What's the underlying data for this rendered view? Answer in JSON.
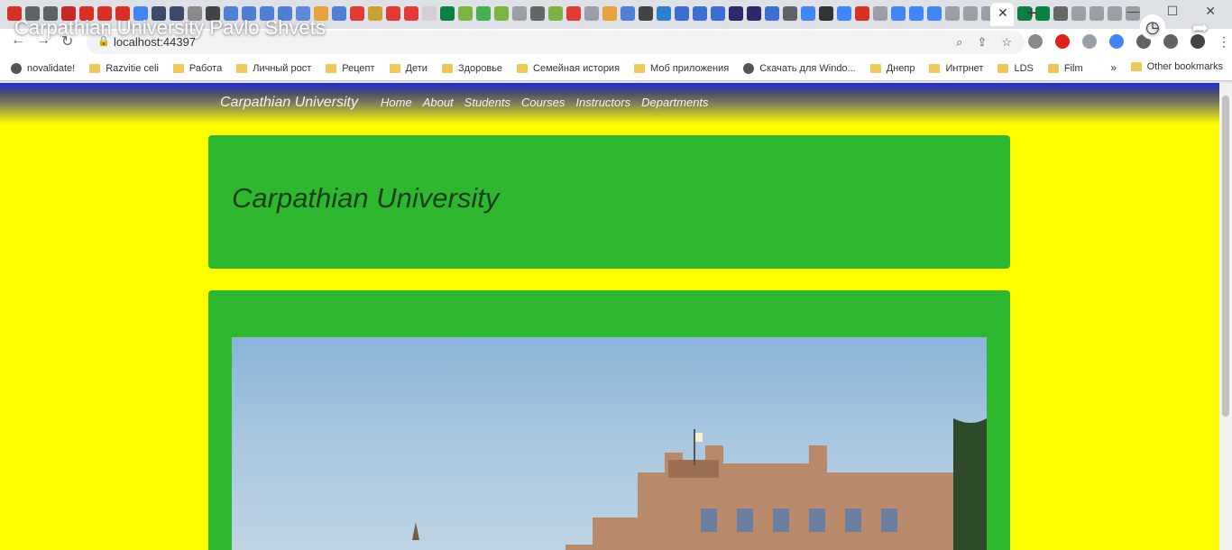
{
  "video": {
    "title": "Carpathian University Pavlo Shvets"
  },
  "browser": {
    "url": "localhost:44397",
    "bookmarks": [
      {
        "label": "novalidate!",
        "icon": "globe"
      },
      {
        "label": "Razvitie celi",
        "icon": "folder"
      },
      {
        "label": "Работа",
        "icon": "folder"
      },
      {
        "label": "Личный рост",
        "icon": "folder"
      },
      {
        "label": "Рецепт",
        "icon": "folder"
      },
      {
        "label": "Дети",
        "icon": "folder"
      },
      {
        "label": "Здоровье",
        "icon": "folder"
      },
      {
        "label": "Семейная история",
        "icon": "folder"
      },
      {
        "label": "Моб приложения",
        "icon": "folder"
      },
      {
        "label": "Скачать для Windo...",
        "icon": "globe"
      },
      {
        "label": "Днепр",
        "icon": "folder"
      },
      {
        "label": "Интрнет",
        "icon": "folder"
      },
      {
        "label": "LDS",
        "icon": "folder"
      },
      {
        "label": "Film",
        "icon": "folder"
      }
    ],
    "bookmarks_more": "»",
    "other_bookmarks": "Other bookmarks"
  },
  "site": {
    "brand": "Carpathian University",
    "nav": [
      "Home",
      "About",
      "Students",
      "Courses",
      "Instructors",
      "Departments"
    ],
    "hero_title": "Carpathian University"
  },
  "colors": {
    "page_bg": "#ffff00",
    "panel": "#2db830",
    "nav_top": "#1f2ad6"
  }
}
